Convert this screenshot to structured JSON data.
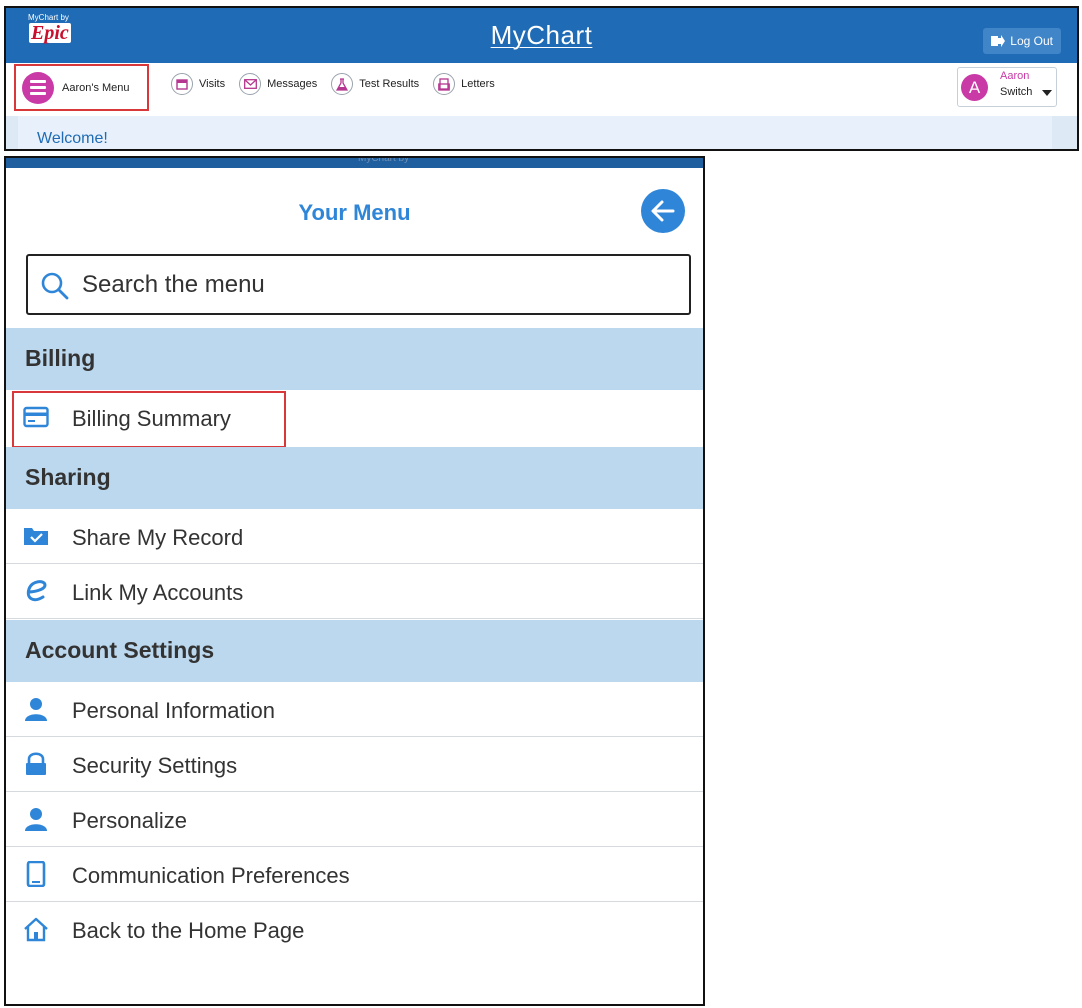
{
  "topbar": {
    "logo_small": "MyChart by",
    "logo_brand": "Epic",
    "title": "MyChart",
    "logout_label": "Log Out"
  },
  "nav": {
    "menu_label": "Aaron's Menu",
    "items": [
      {
        "label": "Visits",
        "icon": "calendar-icon"
      },
      {
        "label": "Messages",
        "icon": "envelope-icon"
      },
      {
        "label": "Test Results",
        "icon": "flask-icon"
      },
      {
        "label": "Letters",
        "icon": "letter-icon"
      }
    ],
    "user_initial": "A",
    "user_name": "Aaron",
    "switch_label": "Switch"
  },
  "welcome": "Welcome!",
  "panel": {
    "top_cut_text": "MyChart by",
    "title": "Your Menu",
    "search_placeholder": "Search the menu",
    "sections": [
      {
        "title": "Billing",
        "items": [
          {
            "label": "Billing Summary",
            "icon": "credit-card-icon"
          }
        ]
      },
      {
        "title": "Sharing",
        "items": [
          {
            "label": "Share My Record",
            "icon": "folder-share-icon"
          },
          {
            "label": "Link My Accounts",
            "icon": "link-e-icon"
          }
        ]
      },
      {
        "title": "Account Settings",
        "items": [
          {
            "label": "Personal Information",
            "icon": "person-icon"
          },
          {
            "label": "Security Settings",
            "icon": "lock-icon"
          },
          {
            "label": "Personalize",
            "icon": "person-icon"
          },
          {
            "label": "Communication Preferences",
            "icon": "phone-icon"
          },
          {
            "label": "Back to the Home Page",
            "icon": "home-icon"
          }
        ]
      }
    ]
  },
  "colors": {
    "brand_blue": "#1f6bb5",
    "accent_magenta": "#c93aa6",
    "section_bg": "#bcd8ee",
    "highlight": "#d9383a",
    "title_blue": "#2f86d8"
  }
}
